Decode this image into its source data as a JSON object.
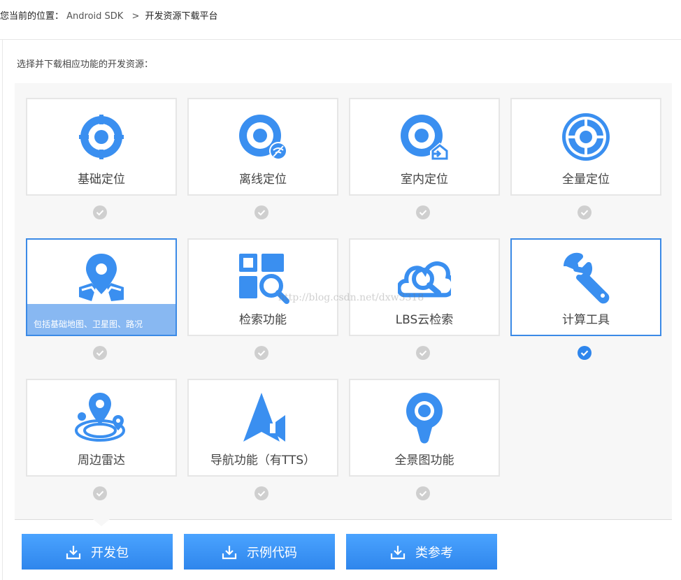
{
  "breadcrumb": {
    "prefix": "您当前的位置：",
    "sdk": "Android SDK",
    "separator": ">",
    "current": "开发资源下载平台"
  },
  "intro": "选择并下载相应功能的开发资源：",
  "watermark": "http://blog.csdn.net/dxw3318",
  "colors": {
    "accent": "#3b8ae6",
    "icon": "#3a8ff0",
    "check_off": "#cfcfcf",
    "check_on": "#2f86ec"
  },
  "features": [
    {
      "label": "基础定位",
      "icon": "location-target-icon",
      "selected": false
    },
    {
      "label": "离线定位",
      "icon": "offline-location-icon",
      "selected": false
    },
    {
      "label": "室内定位",
      "icon": "indoor-location-icon",
      "selected": false
    },
    {
      "label": "全量定位",
      "icon": "full-location-icon",
      "selected": false
    },
    {
      "label": "",
      "icon": "map-pin-icon",
      "selected": true,
      "overlay": "包括基础地图、卫星图、路况"
    },
    {
      "label": "检索功能",
      "icon": "search-grid-icon",
      "selected": false
    },
    {
      "label": "LBS云检索",
      "icon": "cloud-search-icon",
      "selected": false
    },
    {
      "label": "计算工具",
      "icon": "wrench-icon",
      "selected": true,
      "checked": true
    },
    {
      "label": "周边雷达",
      "icon": "radar-pin-icon",
      "selected": false
    },
    {
      "label": "导航功能（有TTS）",
      "icon": "navigation-arrow-icon",
      "selected": false
    },
    {
      "label": "全景图功能",
      "icon": "panorama-pin-icon",
      "selected": false
    }
  ],
  "buttons": [
    {
      "label": "开发包",
      "icon": "download-icon"
    },
    {
      "label": "示例代码",
      "icon": "download-icon"
    },
    {
      "label": "类参考",
      "icon": "download-icon"
    }
  ]
}
